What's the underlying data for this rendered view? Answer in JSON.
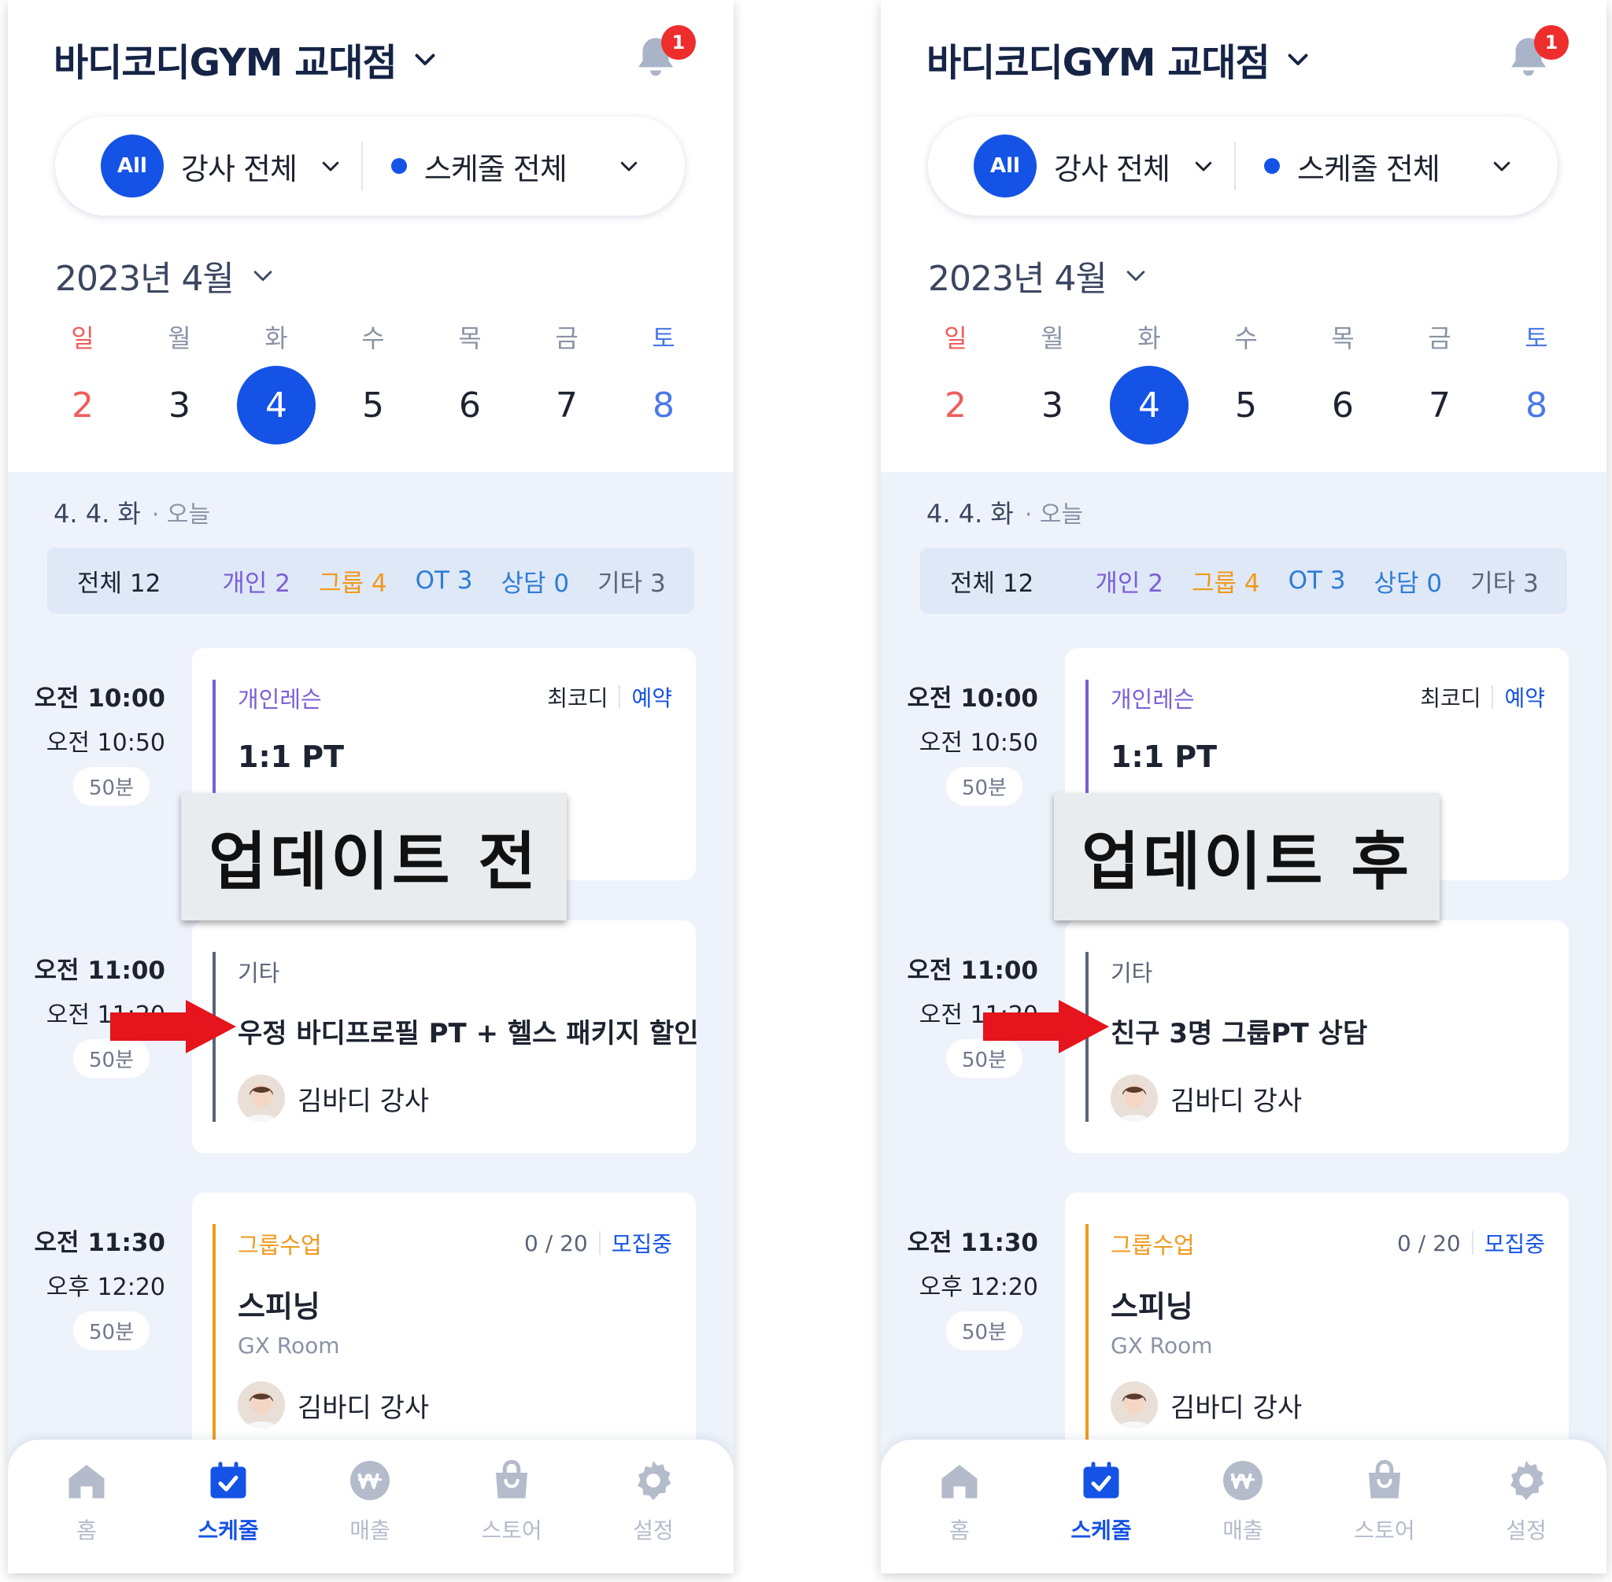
{
  "gym_name": "바디코디GYM 교대점",
  "notification_count": "1",
  "filters": {
    "all_badge": "All",
    "trainer_filter": "강사 전체",
    "schedule_filter": "스케줄 전체"
  },
  "month_label": "2023년 4월",
  "week": [
    {
      "label": "일",
      "num": "2"
    },
    {
      "label": "월",
      "num": "3"
    },
    {
      "label": "화",
      "num": "4"
    },
    {
      "label": "수",
      "num": "5"
    },
    {
      "label": "목",
      "num": "6"
    },
    {
      "label": "금",
      "num": "7"
    },
    {
      "label": "토",
      "num": "8"
    }
  ],
  "selected_day": "4",
  "date_header": {
    "date": "4. 4. 화",
    "today": "· 오늘"
  },
  "stats": {
    "total": "전체 12",
    "personal": "개인 2",
    "group": "그룹 4",
    "ot": "OT 3",
    "consult": "상담 0",
    "etc": "기타 3"
  },
  "sessions": [
    {
      "start": "오전 10:00",
      "end": "오전 10:50",
      "duration": "50분",
      "category": "개인레슨",
      "member": "최코디",
      "status": "예약",
      "title": "1:1 PT"
    },
    {
      "start": "오전 11:00",
      "end": "오전 11:20",
      "duration": "50분",
      "category": "기타",
      "trainer": "김바디 강사"
    },
    {
      "start": "오전 11:30",
      "end": "오후 12:20",
      "duration": "50분",
      "category": "그룹수업",
      "capacity": "0 / 20",
      "status": "모집중",
      "title": "스피닝",
      "room": "GX Room",
      "trainer": "김바디 강사"
    }
  ],
  "before": {
    "overlay": "업데이트 전",
    "etc_title": "우정 바디프로필 PT + 헬스 패키지 할인"
  },
  "after": {
    "overlay": "업데이트 후",
    "etc_title": "친구 3명 그룹PT 상담"
  },
  "tabs": [
    {
      "label": "홈",
      "icon": "home-icon"
    },
    {
      "label": "스케줄",
      "icon": "calendar-check-icon"
    },
    {
      "label": "매출",
      "icon": "won-icon"
    },
    {
      "label": "스토어",
      "icon": "shopping-bag-icon"
    },
    {
      "label": "설정",
      "icon": "gear-icon"
    }
  ],
  "colors": {
    "brand": "#1553e6",
    "personal": "#7b5ed6",
    "group": "#ef9a1d",
    "etc_bar": "#5a6478",
    "badge": "#ee2d2d",
    "arrow": "#e5141d"
  }
}
